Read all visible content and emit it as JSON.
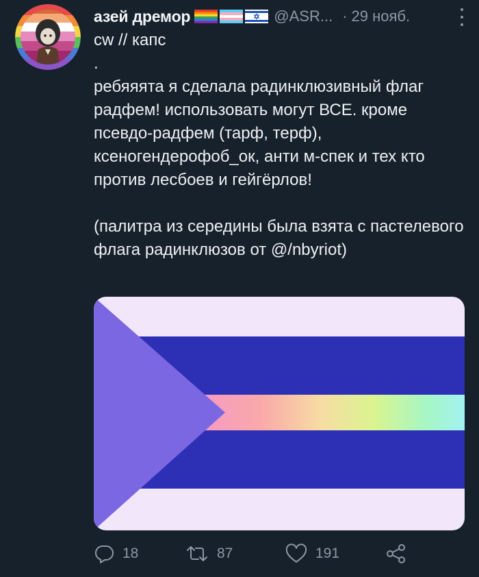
{
  "tweet": {
    "author": {
      "display_name": "азей дремор",
      "handle": "@ASR...",
      "flag_icons": [
        "rainbow-flag-icon",
        "transgender-flag-icon",
        "israel-flag-icon"
      ]
    },
    "timestamp_separator": "·",
    "timestamp": "29 нояб.",
    "text": {
      "line1": "cw // капс",
      "line2": ".",
      "paragraph1": "ребяяята я сделала радинклюзивный флаг радфем! использовать могут ВСЕ. кроме псевдо-радфем (тарф, терф), ксеногендерофоб_ок, анти м-спек и тех кто против лесбоев и гейгёрлов!",
      "paragraph2": "(палитра из середины была взята с пастелевого флага радинклюзов от @/nbyriot)"
    },
    "media": {
      "description_icon": "flag-image",
      "colors": {
        "light": "#f1e6fa",
        "dark_blue": "#2d2fb4",
        "triangle": "#7c67e2",
        "gradient": [
          "#f79ac3",
          "#f9a9a9",
          "#f7dca4",
          "#dbf48f",
          "#a7f6c4",
          "#a2f3f1"
        ]
      }
    },
    "actions": {
      "reply_count": "18",
      "retweet_count": "87",
      "like_count": "191"
    }
  },
  "colors": {
    "background": "#17212c",
    "text_primary": "#eef1f4",
    "text_secondary": "#8b98a5"
  }
}
